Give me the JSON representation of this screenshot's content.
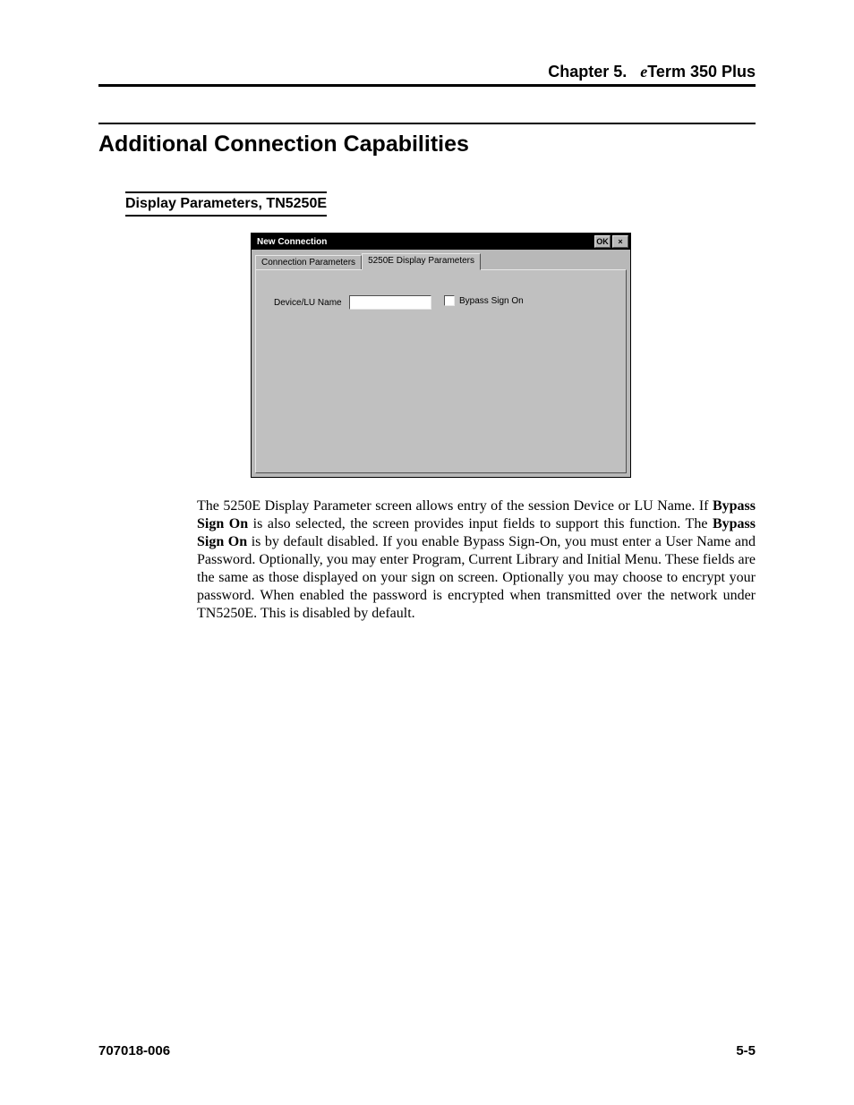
{
  "header": {
    "chapter": "Chapter 5.",
    "product_e": "e",
    "product_rest": "Term 350 Plus"
  },
  "section_title": "Additional Connection Capabilities",
  "subsection_title": "Display Parameters, TN5250E",
  "dialog": {
    "title": "New Connection",
    "ok_label": "OK",
    "close_label": "×",
    "tabs": {
      "inactive": "Connection Parameters",
      "active": "5250E Display Parameters"
    },
    "device_label": "Device/LU Name",
    "device_value": "",
    "bypass_label": "Bypass Sign On"
  },
  "paragraph": {
    "p1a": "The 5250E Display Parameter screen allows entry of the session Device or LU Name. If ",
    "b1": "Bypass Sign On",
    "p1b": " is also selected, the screen provides input fields to support this function. The ",
    "b2": "Bypass Sign On",
    "p1c": " is by default disabled. If you enable Bypass Sign-On, you must enter a User Name and Password. Optionally, you may enter Program, Current Library and Initial Menu. These fields are the same as those displayed on your sign on screen. Optionally you may choose to encrypt your password. When enabled the password is encrypted when transmitted over the network under TN5250E. This is disabled by default."
  },
  "footer": {
    "doc_number": "707018-006",
    "page_number": "5-5"
  }
}
